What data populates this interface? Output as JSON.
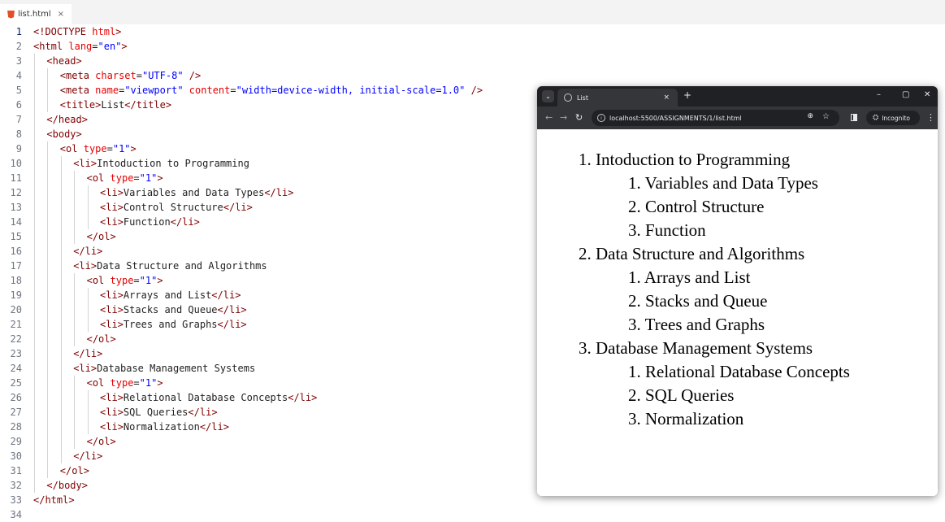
{
  "editor": {
    "tab_name": "list.html",
    "tab_close": "×",
    "lines": [
      {
        "n": "1",
        "indent": 0,
        "tokens": [
          [
            "p",
            "<!"
          ],
          [
            "t",
            "DOCTYPE"
          ],
          [
            "x",
            " "
          ],
          [
            "a",
            "html"
          ],
          [
            "p",
            ">"
          ]
        ]
      },
      {
        "n": "2",
        "indent": 0,
        "tokens": [
          [
            "p",
            "<"
          ],
          [
            "t",
            "html"
          ],
          [
            "x",
            " "
          ],
          [
            "a",
            "lang"
          ],
          [
            "x",
            "="
          ],
          [
            "v",
            "\"en\""
          ],
          [
            "p",
            ">"
          ]
        ]
      },
      {
        "n": "3",
        "indent": 1,
        "tokens": [
          [
            "p",
            "<"
          ],
          [
            "t",
            "head"
          ],
          [
            "p",
            ">"
          ]
        ]
      },
      {
        "n": "4",
        "indent": 2,
        "tokens": [
          [
            "p",
            "<"
          ],
          [
            "t",
            "meta"
          ],
          [
            "x",
            " "
          ],
          [
            "a",
            "charset"
          ],
          [
            "x",
            "="
          ],
          [
            "v",
            "\"UTF-8\""
          ],
          [
            "x",
            " "
          ],
          [
            "p",
            "/>"
          ]
        ]
      },
      {
        "n": "5",
        "indent": 2,
        "tokens": [
          [
            "p",
            "<"
          ],
          [
            "t",
            "meta"
          ],
          [
            "x",
            " "
          ],
          [
            "a",
            "name"
          ],
          [
            "x",
            "="
          ],
          [
            "v",
            "\"viewport\""
          ],
          [
            "x",
            " "
          ],
          [
            "a",
            "content"
          ],
          [
            "x",
            "="
          ],
          [
            "v",
            "\"width=device-width, initial-scale=1.0\""
          ],
          [
            "x",
            " "
          ],
          [
            "p",
            "/>"
          ]
        ]
      },
      {
        "n": "6",
        "indent": 2,
        "tokens": [
          [
            "p",
            "<"
          ],
          [
            "t",
            "title"
          ],
          [
            "p",
            ">"
          ],
          [
            "x",
            "List"
          ],
          [
            "p",
            "</"
          ],
          [
            "t",
            "title"
          ],
          [
            "p",
            ">"
          ]
        ]
      },
      {
        "n": "7",
        "indent": 1,
        "tokens": [
          [
            "p",
            "</"
          ],
          [
            "t",
            "head"
          ],
          [
            "p",
            ">"
          ]
        ]
      },
      {
        "n": "8",
        "indent": 1,
        "tokens": [
          [
            "p",
            "<"
          ],
          [
            "t",
            "body"
          ],
          [
            "p",
            ">"
          ]
        ]
      },
      {
        "n": "9",
        "indent": 2,
        "tokens": [
          [
            "p",
            "<"
          ],
          [
            "t",
            "ol"
          ],
          [
            "x",
            " "
          ],
          [
            "a",
            "type"
          ],
          [
            "x",
            "="
          ],
          [
            "v",
            "\"1\""
          ],
          [
            "p",
            ">"
          ]
        ]
      },
      {
        "n": "10",
        "indent": 3,
        "tokens": [
          [
            "p",
            "<"
          ],
          [
            "t",
            "li"
          ],
          [
            "p",
            ">"
          ],
          [
            "x",
            "Intoduction to Programming"
          ]
        ]
      },
      {
        "n": "11",
        "indent": 4,
        "tokens": [
          [
            "p",
            "<"
          ],
          [
            "t",
            "ol"
          ],
          [
            "x",
            " "
          ],
          [
            "a",
            "type"
          ],
          [
            "x",
            "="
          ],
          [
            "v",
            "\"1\""
          ],
          [
            "p",
            ">"
          ]
        ]
      },
      {
        "n": "12",
        "indent": 5,
        "tokens": [
          [
            "p",
            "<"
          ],
          [
            "t",
            "li"
          ],
          [
            "p",
            ">"
          ],
          [
            "x",
            "Variables and Data Types"
          ],
          [
            "p",
            "</"
          ],
          [
            "t",
            "li"
          ],
          [
            "p",
            ">"
          ]
        ]
      },
      {
        "n": "13",
        "indent": 5,
        "tokens": [
          [
            "p",
            "<"
          ],
          [
            "t",
            "li"
          ],
          [
            "p",
            ">"
          ],
          [
            "x",
            "Control Structure"
          ],
          [
            "p",
            "</"
          ],
          [
            "t",
            "li"
          ],
          [
            "p",
            ">"
          ]
        ]
      },
      {
        "n": "14",
        "indent": 5,
        "tokens": [
          [
            "p",
            "<"
          ],
          [
            "t",
            "li"
          ],
          [
            "p",
            ">"
          ],
          [
            "x",
            "Function"
          ],
          [
            "p",
            "</"
          ],
          [
            "t",
            "li"
          ],
          [
            "p",
            ">"
          ]
        ]
      },
      {
        "n": "15",
        "indent": 4,
        "tokens": [
          [
            "p",
            "</"
          ],
          [
            "t",
            "ol"
          ],
          [
            "p",
            ">"
          ]
        ]
      },
      {
        "n": "16",
        "indent": 3,
        "tokens": [
          [
            "p",
            "</"
          ],
          [
            "t",
            "li"
          ],
          [
            "p",
            ">"
          ]
        ]
      },
      {
        "n": "17",
        "indent": 3,
        "tokens": [
          [
            "p",
            "<"
          ],
          [
            "t",
            "li"
          ],
          [
            "p",
            ">"
          ],
          [
            "x",
            "Data Structure and Algorithms"
          ]
        ]
      },
      {
        "n": "18",
        "indent": 4,
        "tokens": [
          [
            "p",
            "<"
          ],
          [
            "t",
            "ol"
          ],
          [
            "x",
            " "
          ],
          [
            "a",
            "type"
          ],
          [
            "x",
            "="
          ],
          [
            "v",
            "\"1\""
          ],
          [
            "p",
            ">"
          ]
        ]
      },
      {
        "n": "19",
        "indent": 5,
        "tokens": [
          [
            "p",
            "<"
          ],
          [
            "t",
            "li"
          ],
          [
            "p",
            ">"
          ],
          [
            "x",
            "Arrays and List"
          ],
          [
            "p",
            "</"
          ],
          [
            "t",
            "li"
          ],
          [
            "p",
            ">"
          ]
        ]
      },
      {
        "n": "20",
        "indent": 5,
        "tokens": [
          [
            "p",
            "<"
          ],
          [
            "t",
            "li"
          ],
          [
            "p",
            ">"
          ],
          [
            "x",
            "Stacks and Queue"
          ],
          [
            "p",
            "</"
          ],
          [
            "t",
            "li"
          ],
          [
            "p",
            ">"
          ]
        ]
      },
      {
        "n": "21",
        "indent": 5,
        "tokens": [
          [
            "p",
            "<"
          ],
          [
            "t",
            "li"
          ],
          [
            "p",
            ">"
          ],
          [
            "x",
            "Trees and Graphs"
          ],
          [
            "p",
            "</"
          ],
          [
            "t",
            "li"
          ],
          [
            "p",
            ">"
          ]
        ]
      },
      {
        "n": "22",
        "indent": 4,
        "tokens": [
          [
            "p",
            "</"
          ],
          [
            "t",
            "ol"
          ],
          [
            "p",
            ">"
          ]
        ]
      },
      {
        "n": "23",
        "indent": 3,
        "tokens": [
          [
            "p",
            "</"
          ],
          [
            "t",
            "li"
          ],
          [
            "p",
            ">"
          ]
        ]
      },
      {
        "n": "24",
        "indent": 3,
        "tokens": [
          [
            "p",
            "<"
          ],
          [
            "t",
            "li"
          ],
          [
            "p",
            ">"
          ],
          [
            "x",
            "Database Management Systems"
          ]
        ]
      },
      {
        "n": "25",
        "indent": 4,
        "tokens": [
          [
            "p",
            "<"
          ],
          [
            "t",
            "ol"
          ],
          [
            "x",
            " "
          ],
          [
            "a",
            "type"
          ],
          [
            "x",
            "="
          ],
          [
            "v",
            "\"1\""
          ],
          [
            "p",
            ">"
          ]
        ]
      },
      {
        "n": "26",
        "indent": 5,
        "tokens": [
          [
            "p",
            "<"
          ],
          [
            "t",
            "li"
          ],
          [
            "p",
            ">"
          ],
          [
            "x",
            "Relational Database Concepts"
          ],
          [
            "p",
            "</"
          ],
          [
            "t",
            "li"
          ],
          [
            "p",
            ">"
          ]
        ]
      },
      {
        "n": "27",
        "indent": 5,
        "tokens": [
          [
            "p",
            "<"
          ],
          [
            "t",
            "li"
          ],
          [
            "p",
            ">"
          ],
          [
            "x",
            "SQL Queries"
          ],
          [
            "p",
            "</"
          ],
          [
            "t",
            "li"
          ],
          [
            "p",
            ">"
          ]
        ]
      },
      {
        "n": "28",
        "indent": 5,
        "tokens": [
          [
            "p",
            "<"
          ],
          [
            "t",
            "li"
          ],
          [
            "p",
            ">"
          ],
          [
            "x",
            "Normalization"
          ],
          [
            "p",
            "</"
          ],
          [
            "t",
            "li"
          ],
          [
            "p",
            ">"
          ]
        ]
      },
      {
        "n": "29",
        "indent": 4,
        "tokens": [
          [
            "p",
            "</"
          ],
          [
            "t",
            "ol"
          ],
          [
            "p",
            ">"
          ]
        ]
      },
      {
        "n": "30",
        "indent": 3,
        "tokens": [
          [
            "p",
            "</"
          ],
          [
            "t",
            "li"
          ],
          [
            "p",
            ">"
          ]
        ]
      },
      {
        "n": "31",
        "indent": 2,
        "tokens": [
          [
            "p",
            "</"
          ],
          [
            "t",
            "ol"
          ],
          [
            "p",
            ">"
          ]
        ]
      },
      {
        "n": "32",
        "indent": 1,
        "tokens": [
          [
            "p",
            "</"
          ],
          [
            "t",
            "body"
          ],
          [
            "p",
            ">"
          ]
        ]
      },
      {
        "n": "33",
        "indent": 0,
        "tokens": [
          [
            "p",
            "</"
          ],
          [
            "t",
            "html"
          ],
          [
            "p",
            ">"
          ]
        ]
      },
      {
        "n": "34",
        "indent": 0,
        "tokens": []
      }
    ]
  },
  "browser": {
    "tab_title": "List",
    "tab_close": "×",
    "new_tab": "+",
    "url": "localhost:5500/ASSIGNMENTS/1/list.html",
    "incognito_label": "Incognito",
    "window_controls": [
      "–",
      "▢",
      "✕"
    ],
    "list": [
      {
        "num": "1.",
        "text": "Intoduction to Programming",
        "children": [
          {
            "num": "1.",
            "text": "Variables and Data Types"
          },
          {
            "num": "2.",
            "text": "Control Structure"
          },
          {
            "num": "3.",
            "text": "Function"
          }
        ]
      },
      {
        "num": "2.",
        "text": "Data Structure and Algorithms",
        "children": [
          {
            "num": "1.",
            "text": "Arrays and List"
          },
          {
            "num": "2.",
            "text": "Stacks and Queue"
          },
          {
            "num": "3.",
            "text": "Trees and Graphs"
          }
        ]
      },
      {
        "num": "3.",
        "text": "Database Management Systems",
        "children": [
          {
            "num": "1.",
            "text": "Relational Database Concepts"
          },
          {
            "num": "2.",
            "text": "SQL Queries"
          },
          {
            "num": "3.",
            "text": "Normalization"
          }
        ]
      }
    ]
  },
  "colors": {
    "tag": "#800000",
    "attribute": "#e50000",
    "value": "#0000ff",
    "text": "#222222",
    "browser_chrome": "#35363a",
    "html_icon": "#e44d26"
  }
}
